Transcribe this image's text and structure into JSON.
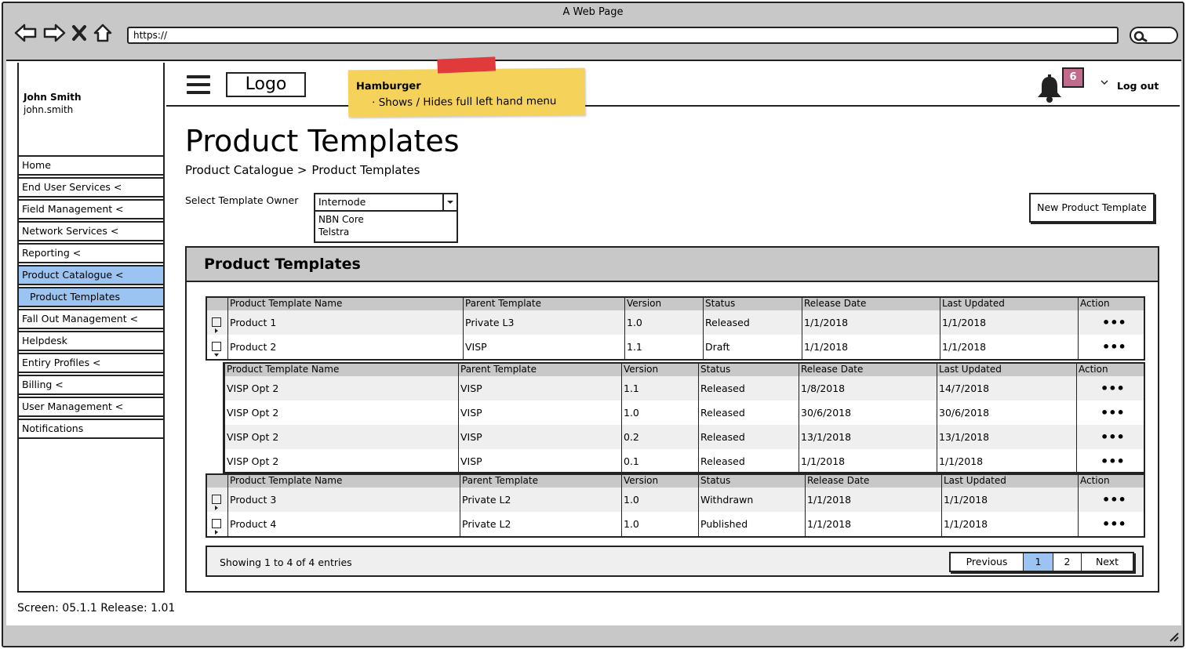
{
  "browser": {
    "title": "A Web Page",
    "url": "https://"
  },
  "user": {
    "name": "John Smith",
    "username": "john.smith"
  },
  "sidebar": {
    "items": [
      {
        "label": "Home"
      },
      {
        "label": "End User Services <"
      },
      {
        "label": "Field Management <"
      },
      {
        "label": "Network Services <"
      },
      {
        "label": "Reporting <"
      },
      {
        "label": "Product Catalogue <",
        "active": true
      },
      {
        "label": "Product Templates",
        "active": true,
        "sub": true
      },
      {
        "label": "Fall Out Management <"
      },
      {
        "label": "Helpdesk"
      },
      {
        "label": "Entiry Profiles <"
      },
      {
        "label": "Billing <"
      },
      {
        "label": "User Management <"
      },
      {
        "label": "Notifications"
      }
    ]
  },
  "header": {
    "logo": "Logo",
    "note_title": "Hamburger",
    "note_text": "·   Shows / Hides full left hand menu",
    "notification_count": "6",
    "logout": "Log out"
  },
  "main": {
    "title": "Product Templates",
    "breadcrumb": [
      "Product Catalogue >",
      "Product Templates"
    ],
    "select_label": "Select Template Owner",
    "select_value": "Internode",
    "select_options": [
      "NBN Core",
      "Telstra"
    ],
    "new_button": "New Product Template",
    "panel_title": "Product Templates"
  },
  "table": {
    "columns": [
      "Product Template Name",
      "Parent Template",
      "Version",
      "Status",
      "Release Date",
      "Last Updated",
      "Action"
    ],
    "action_glyph": "•••",
    "group1": [
      [
        "Product 1",
        "Private L3",
        "1.0",
        "Released",
        "1/1/2018",
        "1/1/2018"
      ],
      [
        "Product 2",
        "VISP",
        "1.1",
        "Draft",
        "1/1/2018",
        "1/1/2018"
      ]
    ],
    "nested": [
      [
        "VISP Opt 2",
        "VISP",
        "1.1",
        "Released",
        "1/8/2018",
        "14/7/2018"
      ],
      [
        "VISP Opt 2",
        "VISP",
        "1.0",
        "Released",
        "30/6/2018",
        "30/6/2018"
      ],
      [
        "VISP Opt 2",
        "VISP",
        "0.2",
        "Released",
        "13/1/2018",
        "13/1/2018"
      ],
      [
        "VISP Opt 2",
        "VISP",
        "0.1",
        "Released",
        "1/1/2018",
        "1/1/2018"
      ]
    ],
    "group2": [
      [
        "Product 3",
        "Private L2",
        "1.0",
        "Withdrawn",
        "1/1/2018",
        "1/1/2018"
      ],
      [
        "Product 4",
        "Private L2",
        "1.0",
        "Published",
        "1/1/2018",
        "1/1/2018"
      ]
    ]
  },
  "pagination": {
    "summary": "Showing 1 to 4 of 4 entries",
    "previous": "Previous",
    "pages": [
      "1",
      "2"
    ],
    "current": "1",
    "next": "Next"
  },
  "footer": {
    "screen_id": "Screen: 05.1.1 Release: 1.01"
  },
  "colors": {
    "highlight": "#9cc4f2",
    "note": "#f5d35b",
    "badge": "#c06a8e",
    "header_gray": "#c8c8c8"
  }
}
